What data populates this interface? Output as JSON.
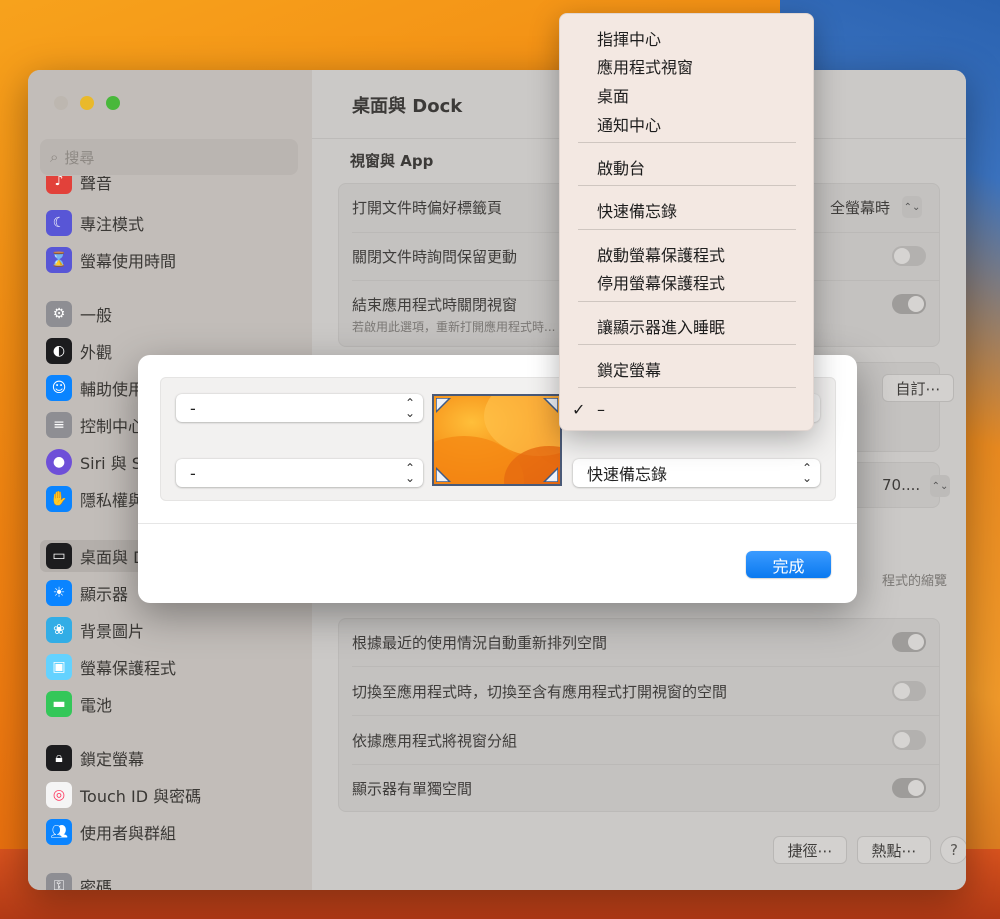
{
  "window": {
    "title": "桌面與 Dock"
  },
  "search": {
    "placeholder": "搜尋"
  },
  "sidebar": {
    "items": [
      {
        "label": "聲音",
        "icon": "speaker-icon",
        "color": "#e2413a"
      },
      {
        "label": "專注模式",
        "icon": "moon-icon",
        "color": "#5856d6"
      },
      {
        "label": "螢幕使用時間",
        "icon": "hourglass-icon",
        "color": "#5856d6"
      },
      {
        "label": "一般",
        "icon": "gear-icon",
        "color": "#8e8e93"
      },
      {
        "label": "外觀",
        "icon": "appearance-icon",
        "color": "#1c1c1e"
      },
      {
        "label": "輔助使用",
        "icon": "accessibility-icon",
        "color": "#0a84ff"
      },
      {
        "label": "控制中心",
        "icon": "switches-icon",
        "color": "#8e8e93"
      },
      {
        "label": "Siri 與 Spotlight",
        "icon": "siri-icon",
        "color": "#6e4fd8"
      },
      {
        "label": "隱私權與安全性",
        "icon": "hand-icon",
        "color": "#0a84ff"
      },
      {
        "label": "桌面與 Dock",
        "icon": "dock-icon",
        "color": "#1c1c1e"
      },
      {
        "label": "顯示器",
        "icon": "sun-icon",
        "color": "#0a84ff"
      },
      {
        "label": "背景圖片",
        "icon": "flower-icon",
        "color": "#32ade6"
      },
      {
        "label": "螢幕保護程式",
        "icon": "screensaver-icon",
        "color": "#64d2ff"
      },
      {
        "label": "電池",
        "icon": "battery-icon",
        "color": "#34c759"
      },
      {
        "label": "鎖定螢幕",
        "icon": "lock-icon",
        "color": "#1c1c1e"
      },
      {
        "label": "Touch ID 與密碼",
        "icon": "fingerprint-icon",
        "color": "#ff375f"
      },
      {
        "label": "使用者與群組",
        "icon": "users-icon",
        "color": "#0a84ff"
      },
      {
        "label": "密碼",
        "icon": "key-icon",
        "color": "#8e8e93"
      }
    ]
  },
  "content": {
    "section_title": "視窗與 App",
    "tab_pref_label": "打開文件時偏好標籤頁",
    "tab_pref_value": "全螢幕時",
    "ask_keep_label": "關閉文件時詢問保留更動",
    "close_windows_label": "結束應用程式時關閉視窗",
    "close_windows_sub": "若啟用此選項，重新打開應用程式時...",
    "customize_button": "自訂⋯",
    "partial_value": "70....",
    "partial_text": "程式的縮覽",
    "mc_rows": [
      "根據最近的使用情況自動重新排列空間",
      "切換至應用程式時，切換至含有應用程式打開視窗的空間",
      "依據應用程式將視窗分組",
      "顯示器有單獨空間"
    ],
    "shortcuts_button": "捷徑⋯",
    "hot_corners_button": "熱點⋯",
    "help_button": "?"
  },
  "modal": {
    "top_left_value": "-",
    "bottom_left_value": "-",
    "bottom_right_value": "快速備忘錄",
    "done_button": "完成"
  },
  "menu": {
    "items": [
      "指揮中心",
      "應用程式視窗",
      "桌面",
      "通知中心",
      "啟動台",
      "快速備忘錄",
      "啟動螢幕保護程式",
      "停用螢幕保護程式",
      "讓顯示器進入睡眠",
      "鎖定螢幕",
      "–"
    ],
    "checked_mark": "✓"
  }
}
